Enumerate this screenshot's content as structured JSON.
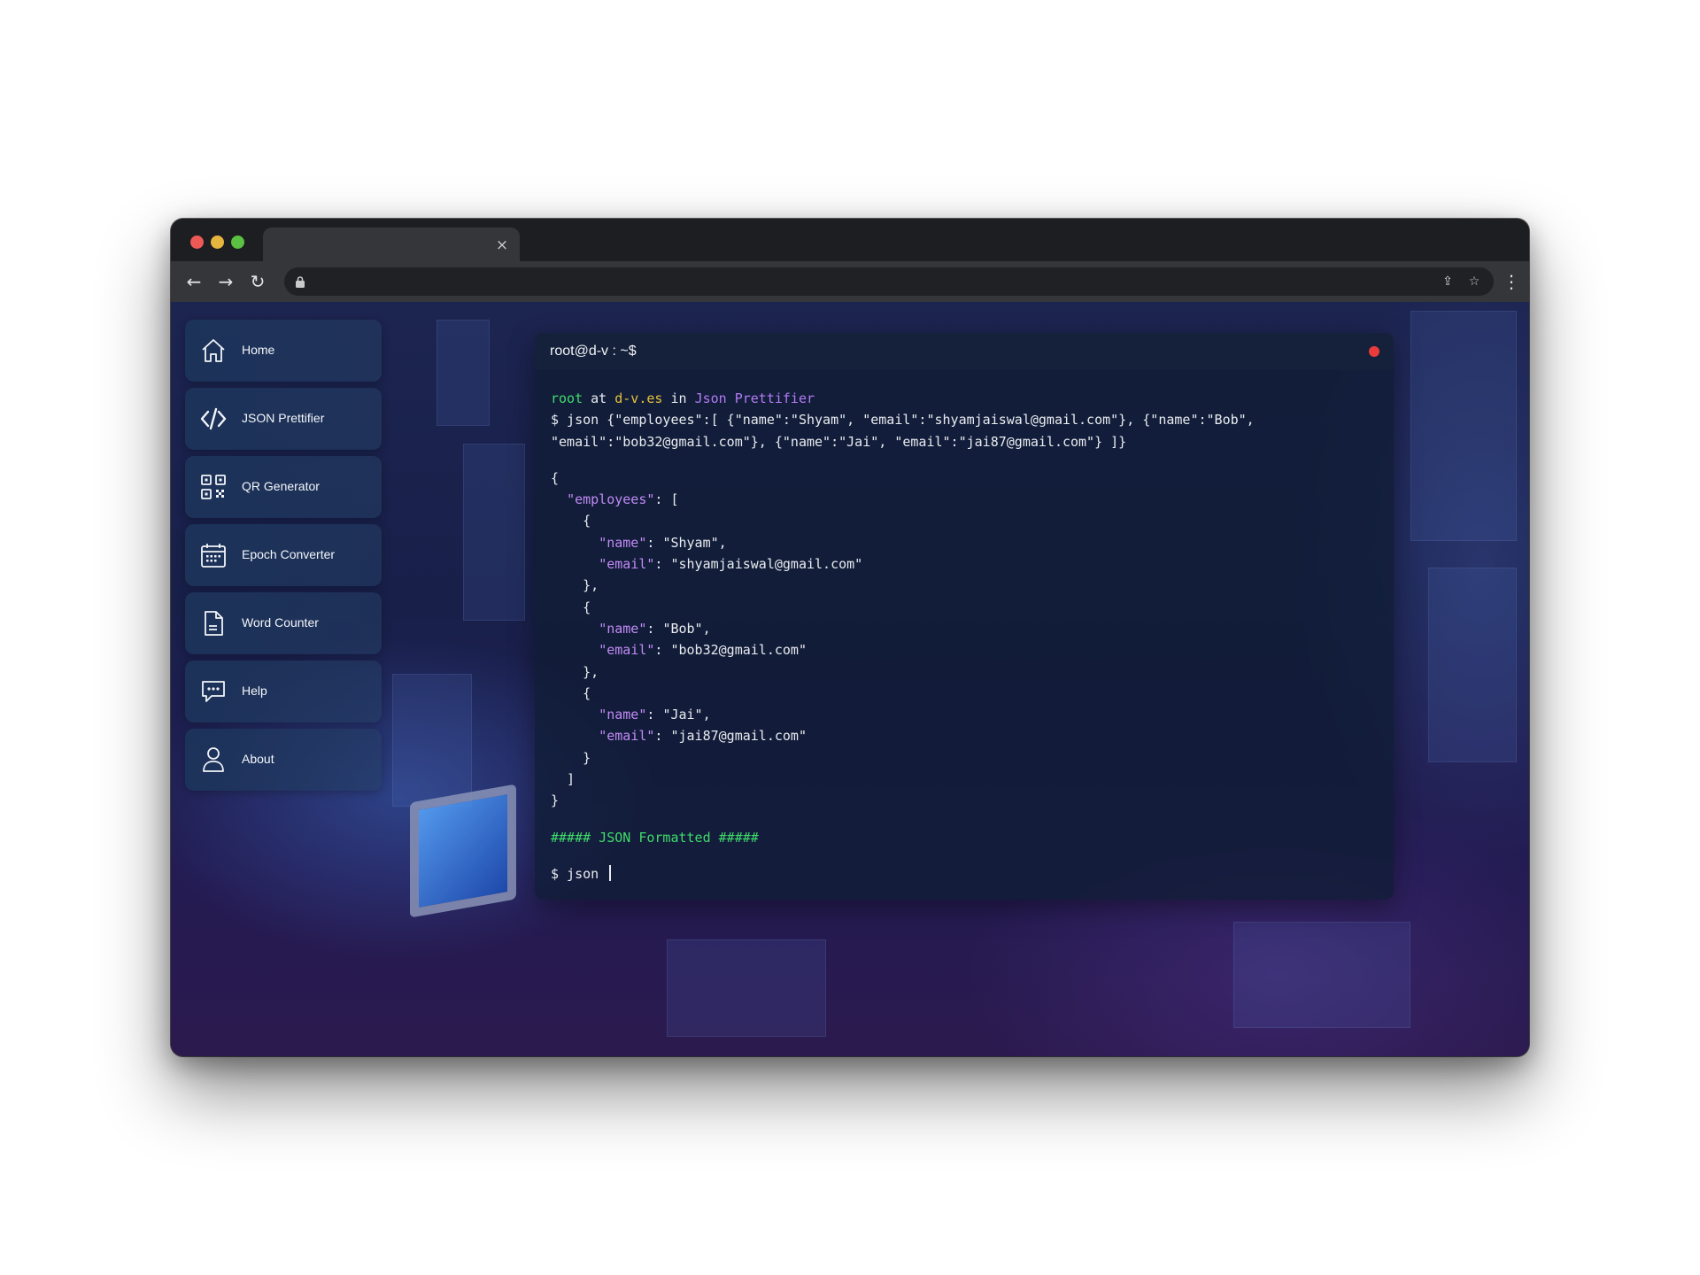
{
  "browser": {
    "tab_close": "×",
    "nav": {
      "back": "←",
      "forward": "→",
      "reload": "↻"
    },
    "omnibox": {
      "share": "⇪",
      "star": "☆"
    },
    "menu": "⋮"
  },
  "sidebar": {
    "items": [
      {
        "label": "Home",
        "icon": "home-icon"
      },
      {
        "label": "JSON Prettifier",
        "icon": "code-icon"
      },
      {
        "label": "QR Generator",
        "icon": "qr-code-icon"
      },
      {
        "label": "Epoch Converter",
        "icon": "calendar-icon"
      },
      {
        "label": "Word Counter",
        "icon": "document-icon"
      },
      {
        "label": "Help",
        "icon": "chat-bubble-icon"
      },
      {
        "label": "About",
        "icon": "user-icon"
      }
    ]
  },
  "terminal": {
    "title": "root@d-v : ~$",
    "prompt": {
      "user": "root",
      "at": " at ",
      "host": "d-v.es",
      "in": " in ",
      "app": "Json Prettifier"
    },
    "command_lines": [
      "$ json {\"employees\":[ {\"name\":\"Shyam\", \"email\":\"shyamjaiswal@gmail.com\"}, {\"name\":\"Bob\",",
      "\"email\":\"bob32@gmail.com\"}, {\"name\":\"Jai\", \"email\":\"jai87@gmail.com\"} ]}"
    ],
    "output": {
      "open_brace": "{",
      "employees_key": "\"employees\"",
      "array_open": ": [",
      "employees": [
        {
          "name": "\"Shyam\"",
          "email": "\"shyamjaiswal@gmail.com\""
        },
        {
          "name": "\"Bob\"",
          "email": "\"bob32@gmail.com\""
        },
        {
          "name": "\"Jai\"",
          "email": "\"jai87@gmail.com\""
        }
      ],
      "name_key": "\"name\"",
      "email_key": "\"email\"",
      "array_close": "  ]",
      "close_brace": "}"
    },
    "status": "##### JSON Formatted #####",
    "input_prompt": "$ json"
  }
}
